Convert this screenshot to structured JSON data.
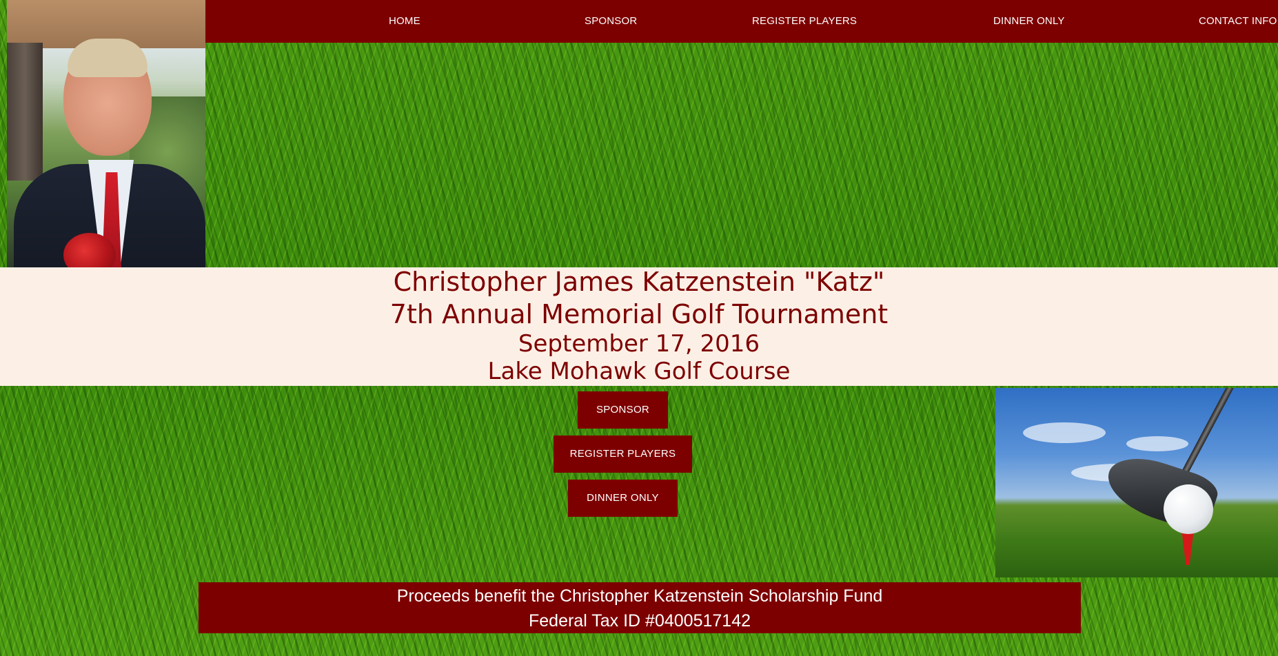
{
  "nav": {
    "home": "HOME",
    "sponsor": "SPONSOR",
    "register_players": "REGISTER PLAYERS",
    "dinner_only": "DINNER ONLY",
    "contact_info": "CONTACT INFO"
  },
  "title": {
    "line1": "Christopher James Katzenstein \"Katz\"",
    "line2": "7th Annual Memorial Golf Tournament",
    "date": "September 17, 2016",
    "venue": "Lake Mohawk Golf Course"
  },
  "buttons": {
    "sponsor": "SPONSOR",
    "register_players": "REGISTER PLAYERS",
    "dinner_only": "DINNER ONLY"
  },
  "footer": {
    "line1": "Proceeds benefit the Christopher Katzenstein Scholarship Fund",
    "line2": "Federal Tax ID #0400517142"
  },
  "colors": {
    "brand": "#7d0000",
    "band_background": "#fcf0e6",
    "text_on_brand": "#ffffff"
  },
  "images": {
    "portrait": "memorial-portrait-photo",
    "golf": "golf-driver-and-ball-photo"
  }
}
